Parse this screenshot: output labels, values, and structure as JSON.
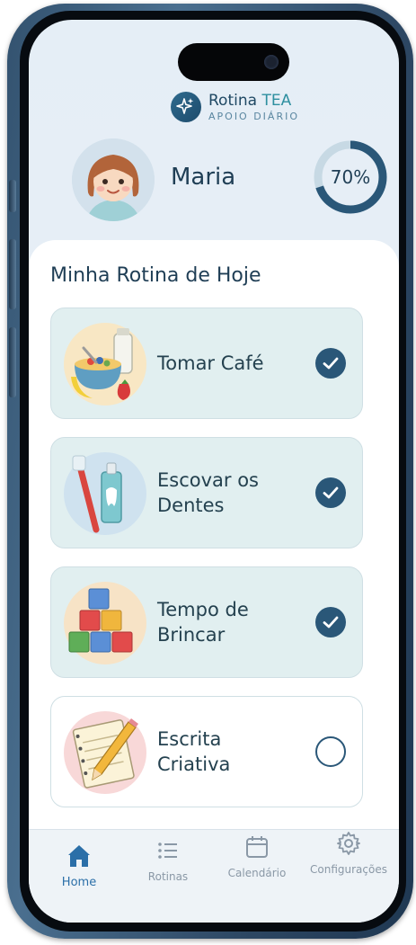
{
  "app": {
    "name": "Rotina",
    "name_accent": "TEA",
    "subtitle": "APOIO DIÁRIO"
  },
  "user": {
    "name": "Maria",
    "progress_percent": 70,
    "progress_label": "70%"
  },
  "routine": {
    "title": "Minha Rotina de Hoje",
    "tasks": [
      {
        "line1": "Tomar Café",
        "line2": "",
        "done": true,
        "icon": "breakfast-icon"
      },
      {
        "line1": "Escovar os",
        "line2": "Dentes",
        "done": true,
        "icon": "toothbrush-icon"
      },
      {
        "line1": "Tempo de",
        "line2": "Brincar",
        "done": true,
        "icon": "toy-blocks-icon"
      },
      {
        "line1": "Escrita",
        "line2": "Criativa",
        "done": false,
        "icon": "notebook-pencil-icon"
      }
    ]
  },
  "nav": {
    "home": "Home",
    "routines": "Rotinas",
    "calendar": "Calendário",
    "settings": "Configurações",
    "active": "home"
  },
  "colors": {
    "primary": "#2a5778",
    "accent": "#2e8fa0",
    "done_card": "#e1eff0",
    "nav_active": "#2b6fa8"
  }
}
